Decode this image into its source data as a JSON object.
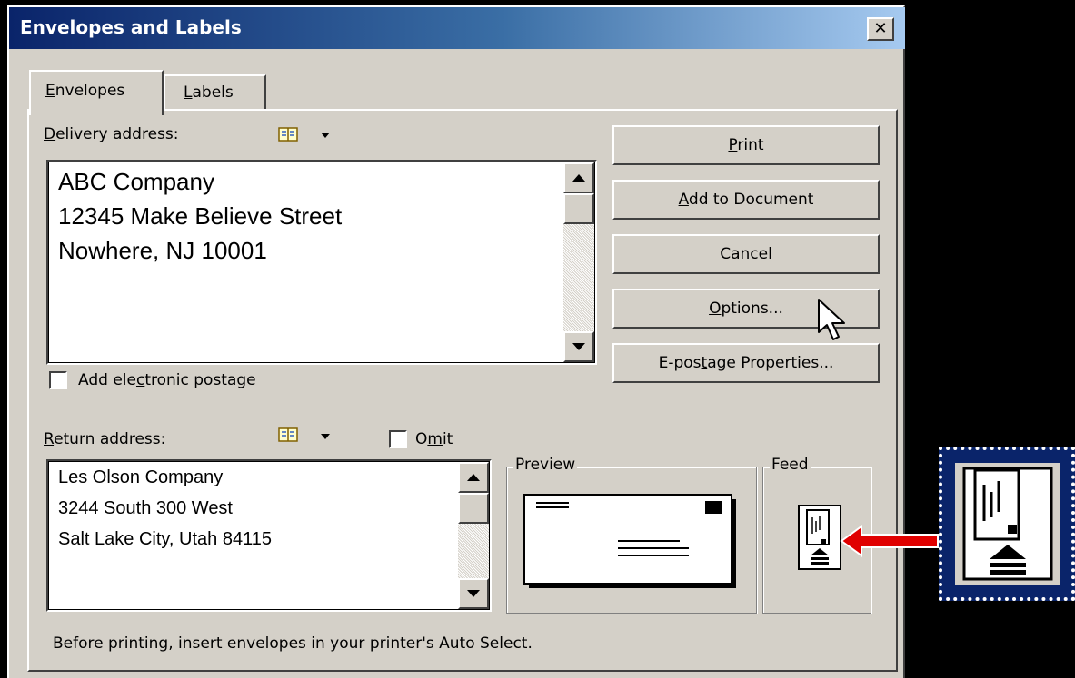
{
  "window": {
    "title": "Envelopes and Labels",
    "close_label": "✕"
  },
  "tabs": [
    {
      "label": "Envelopes",
      "mnemonic": "E",
      "rest": "nvelopes",
      "selected": true
    },
    {
      "label": "Labels",
      "mnemonic": "L",
      "rest": "abels",
      "selected": false
    }
  ],
  "delivery": {
    "label_mn": "D",
    "label_rest": "elivery address:",
    "lines": [
      "ABC Company",
      "12345 Make Believe Street",
      "Nowhere, NJ 10001"
    ]
  },
  "postage": {
    "pre": "Add ele",
    "mn": "c",
    "post": "tronic postage",
    "checked": false
  },
  "return": {
    "label_mn": "R",
    "label_rest": "eturn address:",
    "lines": [
      "Les Olson Company",
      "3244 South 300 West",
      "Salt Lake City, Utah 84115"
    ]
  },
  "omit": {
    "pre": "O",
    "mn": "m",
    "post": "it",
    "checked": false
  },
  "buttons": {
    "print_mn": "P",
    "print_rest": "rint",
    "add_mn": "A",
    "add_rest": "dd to Document",
    "cancel": "Cancel",
    "options_mn": "O",
    "options_rest": "ptions...",
    "epost_pre": "E-pos",
    "epost_mn": "t",
    "epost_post": "age Properties..."
  },
  "preview": {
    "title": "Preview"
  },
  "feed": {
    "title": "Feed"
  },
  "status": "Before printing, insert envelopes in your printer's Auto Select.",
  "colors": {
    "title_start": "#0a246a",
    "title_end": "#a6caf0",
    "face": "#d4d0c8",
    "arrow": "#e00000"
  }
}
